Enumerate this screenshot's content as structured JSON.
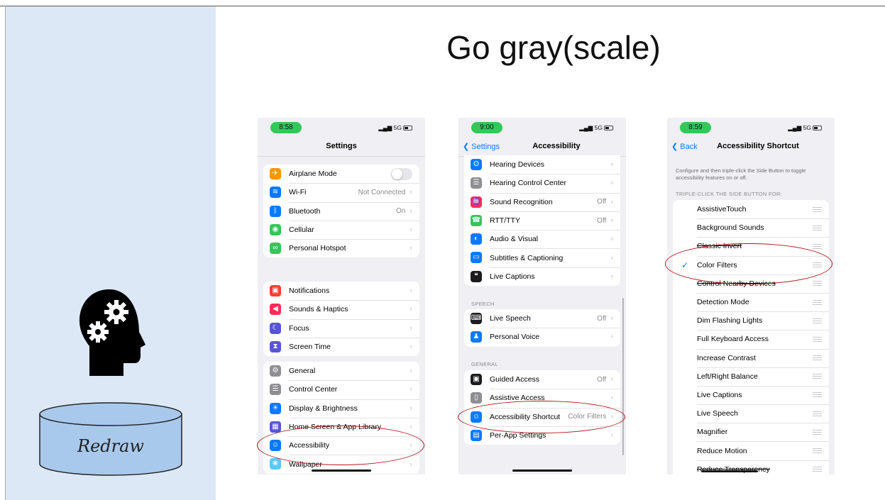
{
  "slide": {
    "title": "Go gray(scale)",
    "db_label": "Redraw"
  },
  "colors": {
    "sidebar": "#dce8f5",
    "highlight": "#b01818",
    "accent": "#0a7aff",
    "pill": "#34c759"
  },
  "phone1": {
    "time": "8:58",
    "signal": "5G",
    "nav_title": "Settings",
    "group1": [
      {
        "label": "Airplane Mode",
        "value": "",
        "icon": "airplane-icon",
        "color": "#ff9500",
        "glyph": "✈",
        "toggle": true
      },
      {
        "label": "Wi-Fi",
        "value": "Not Connected",
        "icon": "wifi-icon",
        "color": "#0a7aff",
        "glyph": "≋"
      },
      {
        "label": "Bluetooth",
        "value": "On",
        "icon": "bluetooth-icon",
        "color": "#0a7aff",
        "glyph": "ᛒ"
      },
      {
        "label": "Cellular",
        "value": "",
        "icon": "cellular-icon",
        "color": "#34c759",
        "glyph": "◉"
      },
      {
        "label": "Personal Hotspot",
        "value": "",
        "icon": "hotspot-icon",
        "color": "#34c759",
        "glyph": "∞"
      }
    ],
    "group2": [
      {
        "label": "Notifications",
        "value": "",
        "icon": "notifications-icon",
        "color": "#ff3b30",
        "glyph": "▣"
      },
      {
        "label": "Sounds & Haptics",
        "value": "",
        "icon": "sound-icon",
        "color": "#ff2d55",
        "glyph": "◀"
      },
      {
        "label": "Focus",
        "value": "",
        "icon": "focus-moon-icon",
        "color": "#5856d6",
        "glyph": "☾"
      },
      {
        "label": "Screen Time",
        "value": "",
        "icon": "hourglass-icon",
        "color": "#5856d6",
        "glyph": "⧗"
      }
    ],
    "group3": [
      {
        "label": "General",
        "value": "",
        "icon": "gear-icon",
        "color": "#8e8e93",
        "glyph": "⚙"
      },
      {
        "label": "Control Center",
        "value": "",
        "icon": "control-center-icon",
        "color": "#8e8e93",
        "glyph": "☰"
      },
      {
        "label": "Display & Brightness",
        "value": "",
        "icon": "brightness-icon",
        "color": "#0a7aff",
        "glyph": "☀"
      },
      {
        "label": "Home Screen & App Library",
        "value": "",
        "icon": "home-screen-icon",
        "color": "#5856d6",
        "glyph": "▦"
      },
      {
        "label": "Accessibility",
        "value": "",
        "icon": "accessibility-icon",
        "color": "#0a7aff",
        "glyph": "☺"
      },
      {
        "label": "Wallpaper",
        "value": "",
        "icon": "wallpaper-icon",
        "color": "#5ac8fa",
        "glyph": "❀"
      }
    ]
  },
  "phone2": {
    "time": "9:00",
    "signal": "5G",
    "back": "Settings",
    "nav_title": "Accessibility",
    "group1": [
      {
        "label": "Hearing Devices",
        "value": "",
        "icon": "ear-icon",
        "color": "#0a7aff",
        "glyph": "ʘ"
      },
      {
        "label": "Hearing Control Center",
        "value": "",
        "icon": "hearing-control-icon",
        "color": "#8e8e93",
        "glyph": "☰"
      },
      {
        "label": "Sound Recognition",
        "value": "Off",
        "icon": "sound-recognition-icon",
        "color": "#ff2d55",
        "glyph": "♒"
      },
      {
        "label": "RTT/TTY",
        "value": "Off",
        "icon": "tty-icon",
        "color": "#34c759",
        "glyph": "☎"
      },
      {
        "label": "Audio & Visual",
        "value": "",
        "icon": "audio-visual-icon",
        "color": "#0a7aff",
        "glyph": "◐"
      },
      {
        "label": "Subtitles & Captioning",
        "value": "",
        "icon": "subtitles-icon",
        "color": "#0a7aff",
        "glyph": "▭"
      },
      {
        "label": "Live Captions",
        "value": "",
        "icon": "live-captions-icon",
        "color": "#1c1c1e",
        "glyph": "❝"
      }
    ],
    "speech_header": "SPEECH",
    "group2": [
      {
        "label": "Live Speech",
        "value": "Off",
        "icon": "keyboard-icon",
        "color": "#1c1c1e",
        "glyph": "⌨"
      },
      {
        "label": "Personal Voice",
        "value": "",
        "icon": "personal-voice-icon",
        "color": "#0a7aff",
        "glyph": "♟"
      }
    ],
    "general_header": "GENERAL",
    "group3": [
      {
        "label": "Guided Access",
        "value": "Off",
        "icon": "lock-icon",
        "color": "#1c1c1e",
        "glyph": "▣"
      },
      {
        "label": "Assistive Access",
        "value": "",
        "icon": "assistive-access-icon",
        "color": "#8e8e93",
        "glyph": "▯"
      },
      {
        "label": "Accessibility Shortcut",
        "value": "Color Filters",
        "icon": "accessibility-shortcut-icon",
        "color": "#0a7aff",
        "glyph": "☺"
      },
      {
        "label": "Per-App Settings",
        "value": "",
        "icon": "per-app-icon",
        "color": "#0a7aff",
        "glyph": "▤"
      }
    ]
  },
  "phone3": {
    "time": "8:59",
    "signal": "5G",
    "back": "Back",
    "nav_title": "Accessibility Shortcut",
    "description": "Configure and then triple-click the Side Button to toggle accessibility features on or off.",
    "section_header": "TRIPLE-CLICK THE SIDE BUTTON FOR:",
    "items": [
      {
        "label": "AssistiveTouch",
        "checked": false
      },
      {
        "label": "Background Sounds",
        "checked": false
      },
      {
        "label": "Classic Invert",
        "checked": false
      },
      {
        "label": "Color Filters",
        "checked": true
      },
      {
        "label": "Control Nearby Devices",
        "checked": false
      },
      {
        "label": "Detection Mode",
        "checked": false
      },
      {
        "label": "Dim Flashing Lights",
        "checked": false
      },
      {
        "label": "Full Keyboard Access",
        "checked": false
      },
      {
        "label": "Increase Contrast",
        "checked": false
      },
      {
        "label": "Left/Right Balance",
        "checked": false
      },
      {
        "label": "Live Captions",
        "checked": false
      },
      {
        "label": "Live Speech",
        "checked": false
      },
      {
        "label": "Magnifier",
        "checked": false
      },
      {
        "label": "Reduce Motion",
        "checked": false
      },
      {
        "label": "Reduce Transparency",
        "checked": false
      }
    ]
  }
}
